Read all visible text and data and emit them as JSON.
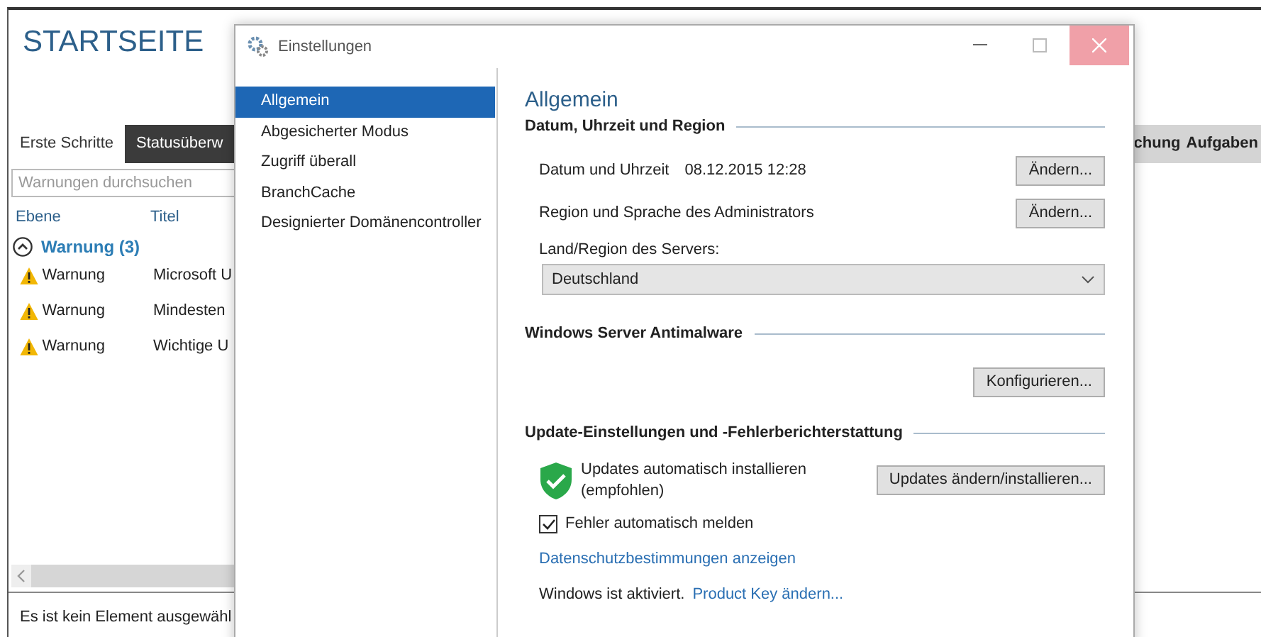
{
  "background_window": {
    "title": "STARTSEITE",
    "tabs": [
      {
        "label": "Erste Schritte",
        "selected": false
      },
      {
        "label": "Statusüberw",
        "selected": true
      }
    ],
    "right_tabs": [
      {
        "label": "chung",
        "selected": false
      },
      {
        "label": "Aufgaben",
        "selected": false
      }
    ],
    "search": {
      "placeholder": "Warnungen durchsuchen"
    },
    "table": {
      "columns": [
        "Ebene",
        "Titel"
      ],
      "groups": [
        {
          "label": "Warnung (3)",
          "expanded": true,
          "rows": [
            {
              "severity": "Warnung",
              "title": "Microsoft U"
            },
            {
              "severity": "Warnung",
              "title": "Mindesten"
            },
            {
              "severity": "Warnung",
              "title": "Wichtige U"
            }
          ]
        }
      ]
    },
    "status_bar": "Es ist kein Element ausgewähl"
  },
  "dialog": {
    "title": "Einstellungen",
    "nav": [
      {
        "label": "Allgemein",
        "selected": true
      },
      {
        "label": "Abgesicherter Modus",
        "selected": false
      },
      {
        "label": "Zugriff überall",
        "selected": false
      },
      {
        "label": "BranchCache",
        "selected": false
      },
      {
        "label": "Designierter Domänencontroller",
        "selected": false
      }
    ],
    "heading": "Allgemein",
    "date_region": {
      "heading": "Datum, Uhrzeit und Region",
      "datetime_label": "Datum und Uhrzeit",
      "datetime_value": "08.12.2015 12:28",
      "datetime_button": "Ändern...",
      "region_label": "Region und Sprache des Administrators",
      "region_button": "Ändern...",
      "country_label": "Land/Region des Servers:",
      "country_value": "Deutschland"
    },
    "antimalware": {
      "heading": "Windows Server Antimalware",
      "button": "Konfigurieren..."
    },
    "updates": {
      "heading": "Update-Einstellungen und -Fehlerberichterstattung",
      "status": "Updates automatisch installieren (empfohlen)",
      "button": "Updates ändern/installieren...",
      "report_errors": {
        "label": "Fehler automatisch melden",
        "checked": true
      },
      "privacy_link": "Datenschutzbestimmungen anzeigen",
      "activation": "Windows ist aktiviert.",
      "product_key_link": "Product Key ändern..."
    }
  }
}
